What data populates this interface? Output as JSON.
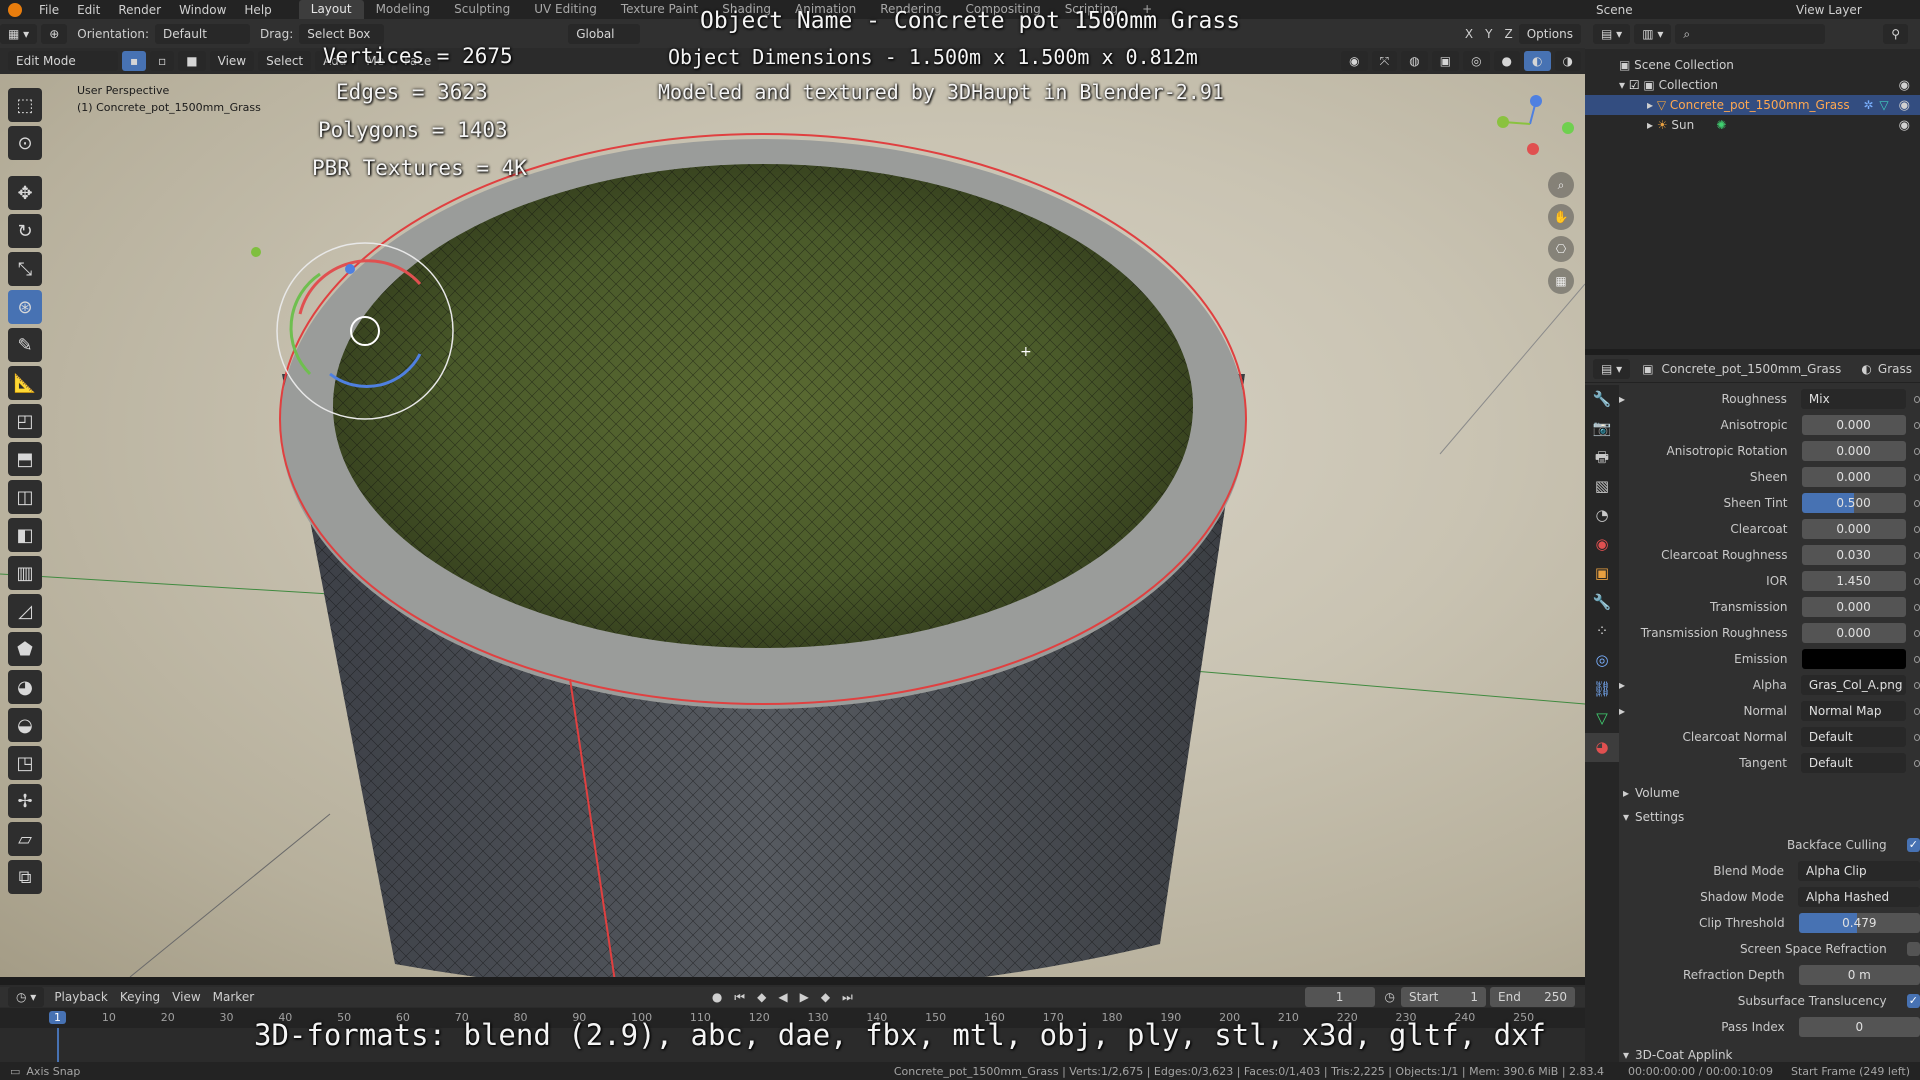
{
  "menubar": {
    "menus": [
      "File",
      "Edit",
      "Render",
      "Window",
      "Help"
    ],
    "workspace_tabs": [
      "Layout",
      "Modeling",
      "Sculpting",
      "UV Editing",
      "Texture Paint",
      "Shading",
      "Animation",
      "Rendering",
      "Compositing",
      "Scripting"
    ],
    "active_tab": "Layout",
    "scene": "Scene",
    "view_layer": "View Layer"
  },
  "header": {
    "orientation_label": "Orientation:",
    "orientation_value": "Default",
    "drag_label": "Drag:",
    "drag_value": "Select Box",
    "transform_orientation": "Global",
    "options": "Options",
    "x": "X",
    "y": "Y",
    "z": "Z"
  },
  "viewport_header": {
    "mode": "Edit Mode",
    "menus": [
      "View",
      "Select",
      "Add"
    ],
    "partial_menus": [
      "Me",
      "Face"
    ]
  },
  "viewport": {
    "perspective": "User Perspective",
    "object_label": "(1) Concrete_pot_1500mm_Grass"
  },
  "overlay": {
    "object_name": "Object Name - Concrete pot 1500mm Grass",
    "dimensions": "Object Dimensions -  1.500m x 1.500m x 0.812m",
    "credits": "Modeled and textured by 3DHaupt in Blender-2.91",
    "vertices": "Vertices = 2675",
    "edges": "Edges = 3623",
    "polygons": "Polygons = 1403",
    "textures": "PBR Textures = 4K",
    "formats": "3D-formats: blend (2.9), abc, dae, fbx, mtl, obj, ply, stl, x3d, gltf, dxf"
  },
  "outliner": {
    "scene_collection": "Scene Collection",
    "collection": "Collection",
    "items": [
      {
        "label": "Concrete_pot_1500mm_Grass",
        "selected": true
      },
      {
        "label": "Sun",
        "selected": false
      }
    ]
  },
  "properties": {
    "object": "Concrete_pot_1500mm_Grass",
    "material": "Grass",
    "rows": [
      {
        "label": "Roughness",
        "value": "Mix",
        "style": "dark",
        "expand": true
      },
      {
        "label": "Anisotropic",
        "value": "0.000",
        "style": "num"
      },
      {
        "label": "Anisotropic Rotation",
        "value": "0.000",
        "style": "num"
      },
      {
        "label": "Sheen",
        "value": "0.000",
        "style": "num"
      },
      {
        "label": "Sheen Tint",
        "value": "0.500",
        "style": "blue",
        "fill": 0.5
      },
      {
        "label": "Clearcoat",
        "value": "0.000",
        "style": "num"
      },
      {
        "label": "Clearcoat Roughness",
        "value": "0.030",
        "style": "num"
      },
      {
        "label": "IOR",
        "value": "1.450",
        "style": "num"
      },
      {
        "label": "Transmission",
        "value": "0.000",
        "style": "num"
      },
      {
        "label": "Transmission Roughness",
        "value": "0.000",
        "style": "num"
      },
      {
        "label": "Emission",
        "value": "",
        "style": "emission"
      },
      {
        "label": "Alpha",
        "value": "Gras_Col_A.png",
        "style": "dark",
        "expand": true
      },
      {
        "label": "Normal",
        "value": "Normal Map",
        "style": "dark",
        "expand": true
      },
      {
        "label": "Clearcoat Normal",
        "value": "Default",
        "style": "dark"
      },
      {
        "label": "Tangent",
        "value": "Default",
        "style": "dark"
      }
    ],
    "volume": "Volume",
    "settings": "Settings",
    "settings_rows": [
      {
        "label": "Backface Culling",
        "type": "check",
        "checked": true
      },
      {
        "label": "Blend Mode",
        "value": "Alpha Clip",
        "type": "select"
      },
      {
        "label": "Shadow Mode",
        "value": "Alpha Hashed",
        "type": "select"
      },
      {
        "label": "Clip Threshold",
        "value": "0.479",
        "type": "blue",
        "fill": 0.479
      },
      {
        "label": "Screen Space Refraction",
        "type": "check",
        "checked": false
      },
      {
        "label": "Refraction Depth",
        "value": "0 m",
        "type": "num"
      },
      {
        "label": "Subsurface Translucency",
        "type": "check",
        "checked": true
      },
      {
        "label": "Pass Index",
        "value": "0",
        "type": "num"
      }
    ],
    "coat_applink": "3D-Coat Applink"
  },
  "timeline": {
    "menus": [
      "Playback",
      "Keying",
      "View",
      "Marker"
    ],
    "current_frame": "1",
    "start_label": "Start",
    "start": "1",
    "end_label": "End",
    "end": "250",
    "ticks": [
      "1",
      "10",
      "20",
      "30",
      "40",
      "50",
      "60",
      "70",
      "80",
      "90",
      "100",
      "110",
      "120",
      "130",
      "140",
      "150",
      "160",
      "170",
      "180",
      "190",
      "200",
      "210",
      "220",
      "230",
      "240",
      "250"
    ]
  },
  "status": {
    "left": "Axis Snap",
    "stats": "Concrete_pot_1500mm_Grass | Verts:1/2,675 | Edges:0/3,623 | Faces:0/1,403 | Tris:2,225 | Objects:1/1 | Mem: 390.6 MiB | 2.83.4",
    "time": "00:00:00:00 / 00:00:10:09",
    "frame": "Start Frame (249 left)"
  }
}
